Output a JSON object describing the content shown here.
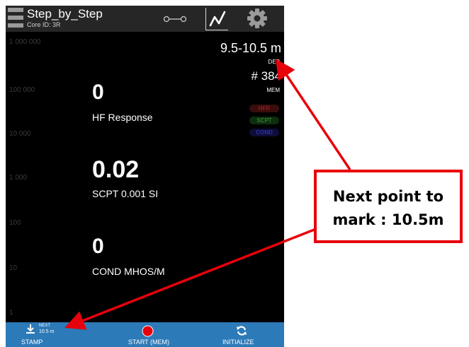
{
  "header": {
    "title": "Step_by_Step",
    "core_id": "Core ID: 3R"
  },
  "scale": [
    "1 000 000",
    "100 000",
    "10 000",
    "1 000",
    "100",
    "10",
    "1"
  ],
  "readouts": {
    "hf": {
      "value": "0",
      "label": "HF Response"
    },
    "scpt": {
      "value": "0.02",
      "label": "SCPT 0.001 SI"
    },
    "cond": {
      "value": "0",
      "label": "COND MHOS/M"
    }
  },
  "status": {
    "depth": "9.5-10.5 m",
    "depth_label": "DEP",
    "mem_count": "# 384",
    "mem_label": "MEM",
    "badges": [
      "HFR",
      "SCPT",
      "COND"
    ]
  },
  "bottom": {
    "stamp_label": "STAMP",
    "next_label": "NEXT",
    "next_value": "10.5 m",
    "start_label": "START (MEM)",
    "initialize_label": "INITIALIZE"
  },
  "callout": {
    "line1": "Next point to",
    "line2": "mark : 10.5m"
  },
  "colors": {
    "topbar": "#262626",
    "bottombar": "#2d7ab8",
    "record": "#e8000b",
    "annotation": "#e8000b"
  },
  "icons": [
    "menu-icon",
    "link-icon",
    "chart-icon",
    "gear-icon",
    "stamp-icon",
    "record-icon",
    "refresh-icon"
  ]
}
